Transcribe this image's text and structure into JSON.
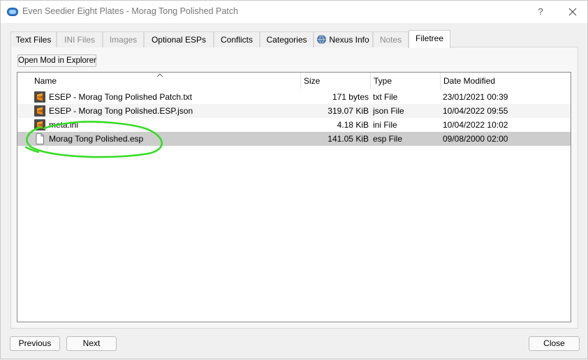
{
  "window": {
    "title": "Even Seedier Eight Plates - Morag Tong Polished Patch",
    "help_label": "?"
  },
  "tabs": [
    {
      "label": "Text Files",
      "state": "normal"
    },
    {
      "label": "INI Files",
      "state": "disabled"
    },
    {
      "label": "Images",
      "state": "disabled"
    },
    {
      "label": "Optional ESPs",
      "state": "normal"
    },
    {
      "label": "Conflicts",
      "state": "normal"
    },
    {
      "label": "Categories",
      "state": "normal"
    },
    {
      "label": "Nexus Info",
      "state": "normal",
      "icon": "globe-icon"
    },
    {
      "label": "Notes",
      "state": "disabled"
    },
    {
      "label": "Filetree",
      "state": "active"
    }
  ],
  "toolbar": {
    "open_explorer_label": "Open Mod in Explorer"
  },
  "tree": {
    "columns": [
      "Name",
      "Size",
      "Type",
      "Date Modified"
    ],
    "sorted_by": "Name",
    "rows": [
      {
        "name": "ESEP - Morag Tong Polished Patch.txt",
        "size": "171 bytes",
        "type": "txt File",
        "date": "23/01/2021 00:39",
        "icon": "sublime-text-icon"
      },
      {
        "name": "ESEP - Morag Tong Polished.ESP.json",
        "size": "319.07 KiB",
        "type": "json File",
        "date": "10/04/2022 09:55",
        "icon": "sublime-text-icon"
      },
      {
        "name": "meta.ini",
        "size": "4.18 KiB",
        "type": "ini File",
        "date": "10/04/2022 10:02",
        "icon": "sublime-text-icon"
      },
      {
        "name": "Morag Tong Polished.esp",
        "size": "141.05 KiB",
        "type": "esp File",
        "date": "09/08/2000 02:00",
        "icon": "blank-file-icon",
        "selected": true
      }
    ]
  },
  "footer": {
    "previous_label": "Previous",
    "next_label": "Next",
    "close_label": "Close"
  },
  "colors": {
    "annotation": "#33dd22",
    "selection": "#cdcdcd",
    "sublime_icon": "#ff8a00"
  }
}
